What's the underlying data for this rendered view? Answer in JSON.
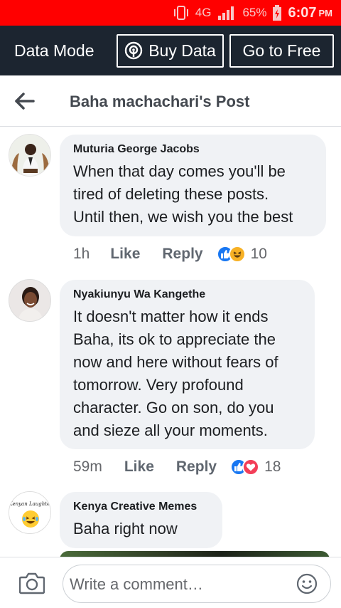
{
  "status_bar": {
    "network": "4G",
    "battery": "65%",
    "time": "6:07",
    "ampm": "PM"
  },
  "data_bar": {
    "mode_label": "Data Mode",
    "buy_label": "Buy Data",
    "free_label": "Go to Free"
  },
  "header": {
    "title": "Baha machachari's Post"
  },
  "comments": [
    {
      "author": "Muturia George Jacobs",
      "lines": [
        "When that day comes you'll be",
        "tired of deleting these posts.",
        "Until then, we wish you the best"
      ],
      "time": "1h",
      "like": "Like",
      "reply": "Reply",
      "reactions": [
        "like",
        "haha"
      ],
      "reaction_count": "10"
    },
    {
      "author": "Nyakiunyu Wa Kangethe",
      "lines": [
        "It doesn't matter how it ends",
        "Baha, its ok to appreciate the",
        "now and here without fears of",
        "tomorrow. Very profound",
        "character. Go on son, do you",
        "and sieze all your moments."
      ],
      "time": "59m",
      "like": "Like",
      "reply": "Reply",
      "reactions": [
        "like",
        "love"
      ],
      "reaction_count": "18"
    },
    {
      "author": "Kenya Creative Memes",
      "lines": [
        "Baha right now"
      ],
      "avatar_text": "Kenyan Laughter"
    }
  ],
  "composer": {
    "placeholder": "Write a comment…"
  },
  "icons": {
    "back": "arrow-left-icon",
    "hotspot": "broadcast-icon",
    "camera": "camera-icon",
    "emoji": "smiley-icon"
  },
  "colors": {
    "status_bar": "#ff0000",
    "data_bar": "#1c2530",
    "bubble": "#f0f2f5",
    "like_blue": "#1877f2",
    "love_red": "#f33e58"
  }
}
